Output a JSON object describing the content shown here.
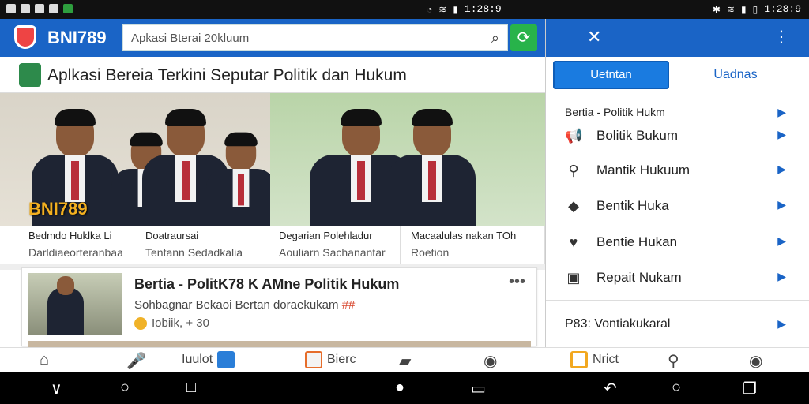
{
  "status": {
    "left_time": "1:28:9",
    "right_time": "1:28:9"
  },
  "header": {
    "brand": "BNI789",
    "search_placeholder": "Apkasi Bterai 20kluum",
    "refresh_icon": "refresh-icon"
  },
  "subhead": {
    "title": "Aplkasi Bereia Terkini Seputar Politik dan Hukum"
  },
  "hero": {
    "brand_tag": "BNI789"
  },
  "captions": [
    {
      "a": "Bedmdo Huklka Li",
      "b": "Darldiaeorteranbaa"
    },
    {
      "a": "Doatraursai",
      "b": "Tentann Sedadkalia"
    },
    {
      "a": "Degarian Polehladur",
      "b": "Aouliarn Sachanantar"
    },
    {
      "a": "Macaalulas nakan TOh",
      "b": "Roetion"
    }
  ],
  "card": {
    "title": "Bertia - PolitK78 K AMne Politik Hukum",
    "subtitle": "Sohbagnar Bekaoi Bertan doraekukam",
    "subtitle_highlight": "##",
    "meta": "Iobiik, + 30",
    "more": "•••"
  },
  "drawer": {
    "tab_active": "Uetntan",
    "tab_other": "Uadnas",
    "section_title": "Bertia - Politik Hukm",
    "items": [
      {
        "label": "Bolitik Bukum",
        "icon": "megaphone-icon"
      },
      {
        "label": "Mantik Hukuum",
        "icon": "search-icon"
      },
      {
        "label": "Bentik Huka",
        "icon": "tag-icon"
      },
      {
        "label": "Bentie Hukan",
        "icon": "heart-icon"
      },
      {
        "label": "Repait Nukam",
        "icon": "briefcase-icon"
      }
    ],
    "footer_item": "P83: Vontiakukaral"
  },
  "bottom_nav": {
    "home": "",
    "search_label": "Iuulot",
    "news_label": "Bierc",
    "right_label": "Nrict"
  }
}
